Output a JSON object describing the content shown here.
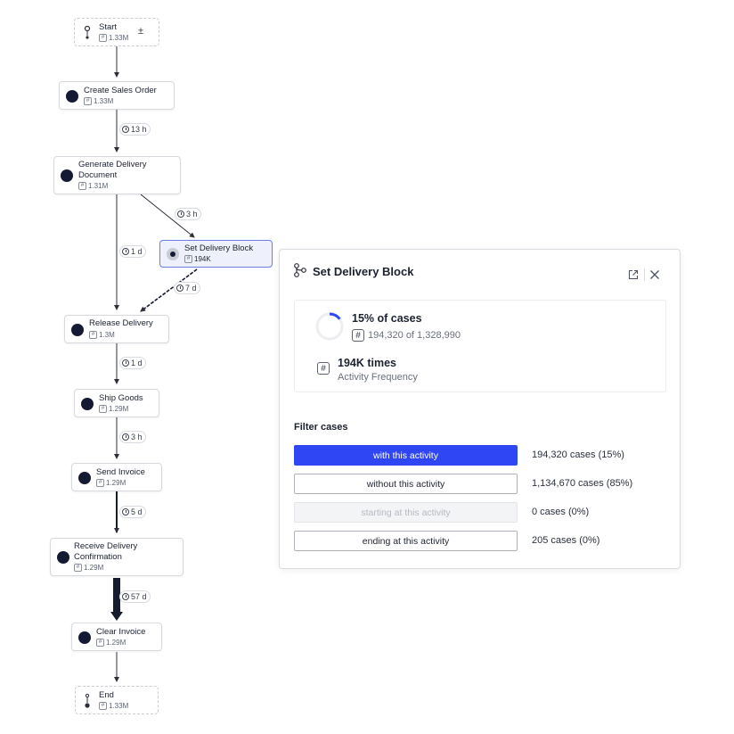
{
  "nodes": {
    "start": {
      "title": "Start",
      "count": "1.33M"
    },
    "create_sales_order": {
      "title": "Create Sales Order",
      "count": "1.33M"
    },
    "generate_delivery_document": {
      "title_line1": "Generate Delivery",
      "title_line2": "Document",
      "count": "1.31M"
    },
    "set_delivery_block": {
      "title": "Set Delivery Block",
      "count": "194K"
    },
    "release_delivery": {
      "title": "Release Delivery",
      "count": "1.3M"
    },
    "ship_goods": {
      "title": "Ship Goods",
      "count": "1.29M"
    },
    "send_invoice": {
      "title": "Send Invoice",
      "count": "1.29M"
    },
    "receive_delivery_confirmation": {
      "title_line1": "Receive Delivery",
      "title_line2": "Confirmation",
      "count": "1.29M"
    },
    "clear_invoice": {
      "title": "Clear Invoice",
      "count": "1.29M"
    },
    "end": {
      "title": "End",
      "count": "1.33M"
    }
  },
  "edge_labels": {
    "create_to_generate": "13 h",
    "generate_to_block": "3 h",
    "generate_to_release": "1 d",
    "block_to_release": "7 d",
    "release_to_ship": "1 d",
    "ship_to_send": "3 h",
    "send_to_receive": "5 d",
    "receive_to_clear": "57 d"
  },
  "icons": {
    "terminal": "start-end-icon",
    "hash": "#",
    "expand": "±",
    "clock": "clock-icon",
    "process": "process-branch-icon",
    "open": "open-external-icon",
    "close": "close-icon"
  },
  "panel": {
    "title": "Set Delivery Block",
    "percent_cases": "15% of cases",
    "percent_value": 0.15,
    "cases_detail": "194,320 of 1,328,990",
    "times": "194K times",
    "times_label": "Activity Frequency",
    "filter_title": "Filter cases",
    "filters": [
      {
        "label": "with this activity",
        "value": "194,320 cases (15%)",
        "state": "selected"
      },
      {
        "label": "without this activity",
        "value": "1,134,670 cases (85%)",
        "state": "default"
      },
      {
        "label": "starting at this activity",
        "value": "0 cases (0%)",
        "state": "disabled"
      },
      {
        "label": "ending at this activity",
        "value": "205 cases (0%)",
        "state": "default"
      }
    ]
  },
  "colors": {
    "accent": "#2f46f5",
    "node_dot": "#141a33",
    "selected_bg": "#eef0fb",
    "selected_border": "#6b7fe6",
    "edge": "#2b2f38"
  }
}
